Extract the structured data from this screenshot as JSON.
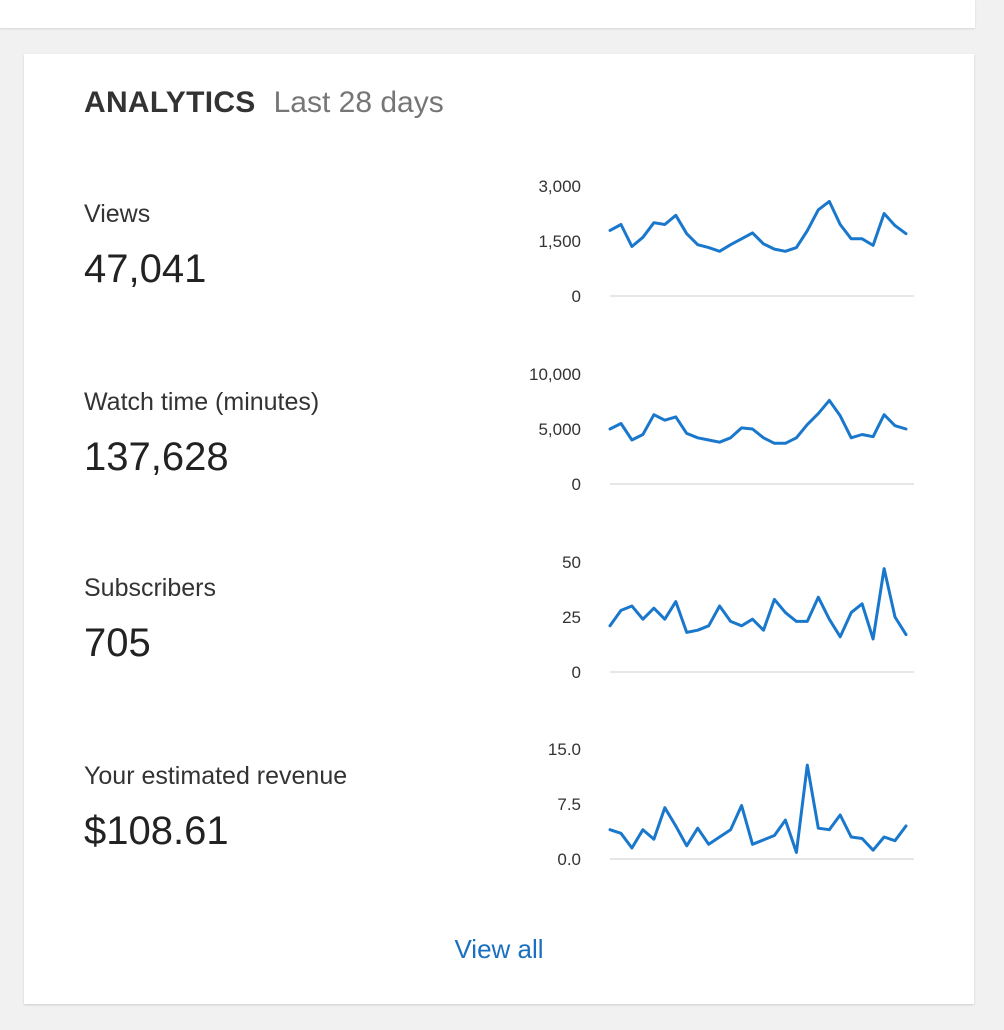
{
  "header": {
    "title": "ANALYTICS",
    "subtitle": "Last 28 days"
  },
  "accent_color": "#1a78cc",
  "metrics": [
    {
      "label": "Views",
      "value": "47,041"
    },
    {
      "label": "Watch time (minutes)",
      "value": "137,628"
    },
    {
      "label": "Subscribers",
      "value": "705"
    },
    {
      "label": "Your estimated revenue",
      "value": "$108.61"
    }
  ],
  "chart_data": [
    {
      "type": "line",
      "ylim": [
        0,
        3000
      ],
      "yticks": [
        "3,000",
        "1,500",
        "0"
      ],
      "values": [
        1790,
        1950,
        1350,
        1600,
        2000,
        1950,
        2200,
        1700,
        1400,
        1320,
        1220,
        1400,
        1560,
        1720,
        1420,
        1280,
        1220,
        1320,
        1780,
        2350,
        2580,
        1950,
        1560,
        1560,
        1380,
        2250,
        1920,
        1700
      ]
    },
    {
      "type": "line",
      "ylim": [
        0,
        10000
      ],
      "yticks": [
        "10,000",
        "5,000",
        "0"
      ],
      "values": [
        5000,
        5500,
        4000,
        4500,
        6300,
        5800,
        6100,
        4600,
        4200,
        4000,
        3800,
        4200,
        5100,
        5000,
        4200,
        3700,
        3700,
        4200,
        5400,
        6400,
        7600,
        6200,
        4200,
        4500,
        4300,
        6300,
        5300,
        5000
      ]
    },
    {
      "type": "line",
      "ylim": [
        0,
        50
      ],
      "yticks": [
        "50",
        "25",
        "0"
      ],
      "values": [
        21,
        28,
        30,
        24,
        29,
        24,
        32,
        18,
        19,
        21,
        30,
        23,
        21,
        24,
        19,
        33,
        27,
        23,
        23,
        34,
        24,
        16,
        27,
        31,
        15,
        47,
        25,
        17
      ]
    },
    {
      "type": "line",
      "ylim": [
        0,
        15
      ],
      "yticks": [
        "15.0",
        "7.5",
        "0.0"
      ],
      "values": [
        4.0,
        3.5,
        1.5,
        4.0,
        2.7,
        7.0,
        4.5,
        1.8,
        4.2,
        2.0,
        3.0,
        4.0,
        7.3,
        2.0,
        2.6,
        3.2,
        5.3,
        0.9,
        12.8,
        4.2,
        4.0,
        6.0,
        3.0,
        2.8,
        1.2,
        3.0,
        2.5,
        4.5
      ]
    }
  ],
  "footer": {
    "view_all": "View all"
  }
}
